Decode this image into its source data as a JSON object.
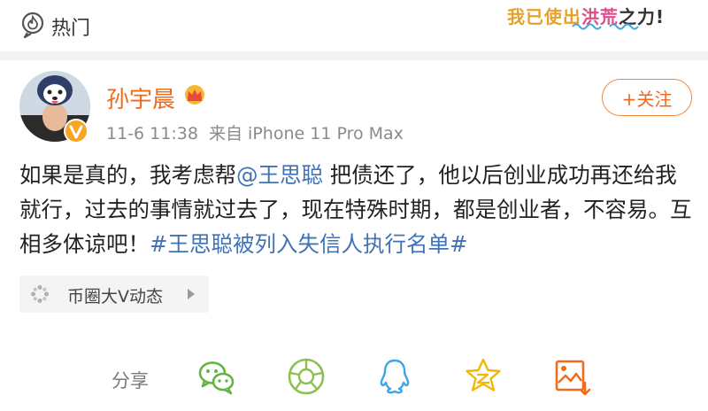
{
  "topbar": {
    "hot_label": "热门",
    "sticker_part1": "我已使出",
    "sticker_part2": "洪荒",
    "sticker_part3": "之力!"
  },
  "post": {
    "author": "孙宇晨",
    "date": "11-6 11:38",
    "source": "来自 iPhone 11 Pro Max",
    "follow_label": "+关注",
    "text_part1": "如果是真的，我考虑帮",
    "mention": "@王思聪",
    "text_part2": " 把债还了，他以后创业成功再还给我就行，过去的事情就过去了，现在特殊时期，都是创业者，不容易。互相多体谅吧！",
    "hashtag": "#王思聪被列入失信人执行名单#"
  },
  "topic_card": {
    "label": "币圈大V动态"
  },
  "share": {
    "label": "分享",
    "targets": [
      "wechat-icon",
      "moments-icon",
      "qq-icon",
      "qzone-icon",
      "save-image-icon"
    ]
  },
  "colors": {
    "author": "#f06a1b",
    "link": "#3f73b6",
    "wechat": "#62b543",
    "moments": "#8cc152",
    "qq": "#3fa6e6",
    "qzone": "#f2b705",
    "save": "#f26a1b"
  }
}
